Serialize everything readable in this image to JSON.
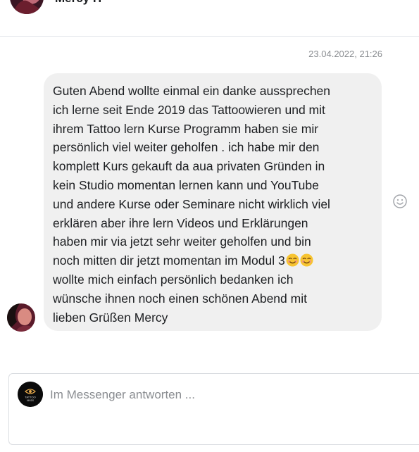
{
  "conversation": {
    "contact_name": "Mercy H"
  },
  "message": {
    "timestamp": "23.04.2022, 21:26",
    "lines": [
      "Guten Abend wollte einmal ein danke aussprechen",
      "ich lerne seit Ende 2019 das Tattoowieren und mit",
      "ihrem  Tattoo lern Kurse Programm haben sie mir",
      "persönlich viel weiter geholfen . ich habe mir den",
      "komplett Kurs gekauft da aua privaten Gründen in",
      "kein Studio momentan lernen kann und YouTube",
      "und andere Kurse oder Seminare nicht wirklich viel",
      "erklären aber ihre lern Videos und Erklärungen",
      "haben mir via jetzt sehr weiter geholfen und bin",
      "noch mitten dir jetzt momentan im Modul 3",
      "wollte mich einfach persönlich bedanken ich",
      "wünsche ihnen noch einen schönen Abend mit",
      "lieben Grüßen Mercy"
    ],
    "emoji_icons": [
      "smiling-face-icon",
      "smiling-face-icon"
    ]
  },
  "composer": {
    "placeholder": "Im Messenger antworten ...",
    "value": "",
    "logo_text_top": "TATTOO",
    "logo_text_bottom": "MINDS"
  },
  "colors": {
    "bubble_background": "#f0f0f0",
    "timestamp_text": "#8a8d91",
    "divider": "#e4e6eb",
    "emoji_face": "#f7c431"
  }
}
